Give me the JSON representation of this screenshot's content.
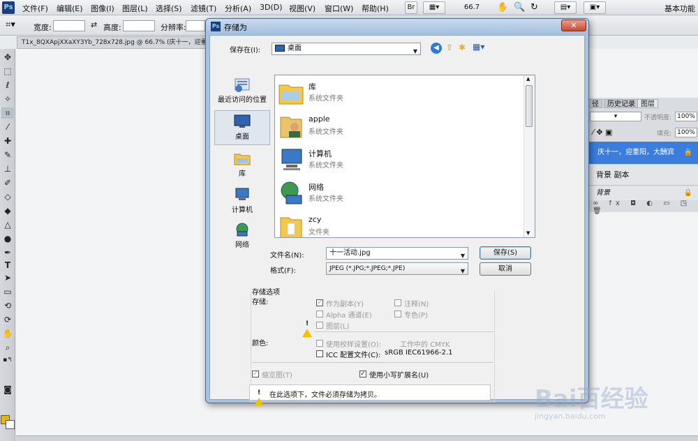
{
  "menubar": {
    "logo": "Ps",
    "items": [
      "文件(F)",
      "编辑(E)",
      "图像(I)",
      "图层(L)",
      "选择(S)",
      "滤镜(T)",
      "分析(A)",
      "3D(D)",
      "视图(V)",
      "窗口(W)",
      "帮助(H)"
    ],
    "bridge_label": "Br",
    "zoom": "66.7",
    "workspace": "基本功能"
  },
  "options_bar": {
    "width_label": "宽度:",
    "height_label": "高度:",
    "resolution_label": "分辨率:"
  },
  "document": {
    "tab_title": "T1x_8QXApjXXaXY3Yb_728x728.jpg @ 66.7% (庆十一，迎重"
  },
  "layers_panel": {
    "tabs": [
      "径",
      "历史记录",
      "图层"
    ],
    "opacity_label": "不透明度:",
    "opacity_value": "100%",
    "fill_label": "填充:",
    "fill_value": "100%",
    "layers": [
      "庆十一，迎重阳，大酬宾",
      "背景 副本",
      "背景"
    ]
  },
  "dialog": {
    "logo": "Ps",
    "title": "存储为",
    "close": "✕",
    "save_in_label": "保存在(I):",
    "save_in_value": "桌面",
    "places": [
      "最近访问的位置",
      "桌面",
      "库",
      "计算机",
      "网络"
    ],
    "files": [
      {
        "name": "库",
        "type": "系统文件夹"
      },
      {
        "name": "apple",
        "type": "系统文件夹"
      },
      {
        "name": "计算机",
        "type": "系统文件夹"
      },
      {
        "name": "网络",
        "type": "系统文件夹"
      },
      {
        "name": "zcy",
        "type": "文件夹"
      }
    ],
    "filename_label": "文件名(N):",
    "filename_value": "十一活动.jpg",
    "format_label": "格式(F):",
    "format_value": "JPEG (*.JPG;*.JPEG;*.JPE)",
    "save_button": "保存(S)",
    "cancel_button": "取消",
    "options": {
      "group_title": "存储选项",
      "save_label": "存储:",
      "as_copy": "作为副本(Y)",
      "notes": "注释(N)",
      "alpha": "Alpha 通道(E)",
      "spot": "专色(P)",
      "layers": "图层(L)",
      "color_label": "颜色:",
      "proof": "使用校样设置(O):",
      "proof_value": "工作中的 CMYK",
      "icc": "ICC 配置文件(C):",
      "icc_value": "sRGB IEC61966-2.1",
      "thumbnail": "缩览图(T)",
      "lowercase_ext": "使用小写扩展名(U)",
      "warning": "在此选项下，文件必须存储为拷贝。"
    }
  },
  "watermark": {
    "text": "Bai百经验",
    "url": "jingyan.baidu.com"
  },
  "colors": {
    "dialog_frame": "#a9c3df",
    "selected_layer": "#3b7ddd",
    "foreground": "#e4b519"
  }
}
